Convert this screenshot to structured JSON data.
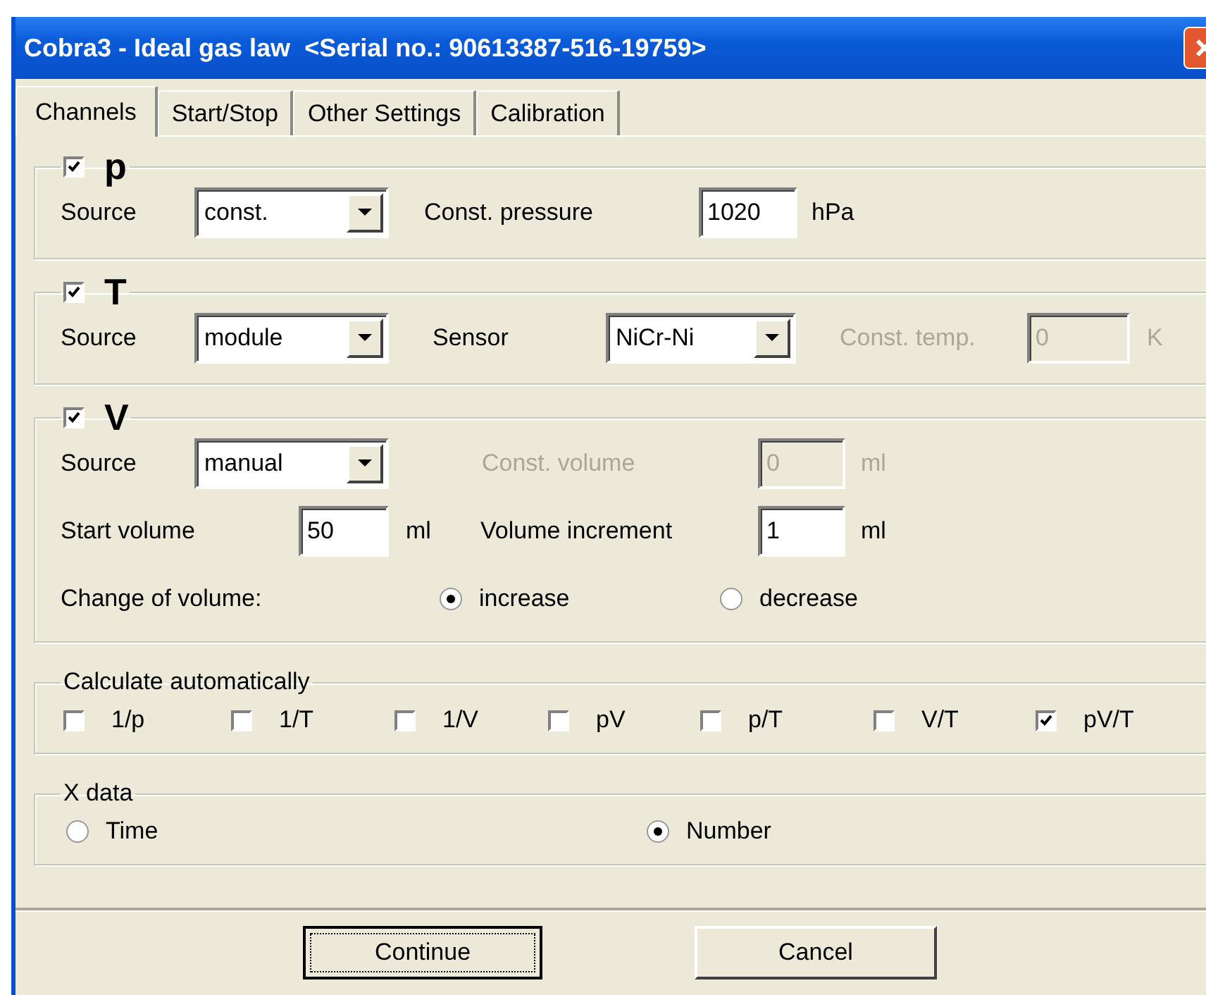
{
  "window": {
    "title": "Cobra3 - Ideal gas law  <Serial no.: 90613387-516-19759>"
  },
  "tabs": [
    {
      "label": "Channels",
      "selected": true
    },
    {
      "label": "Start/Stop",
      "selected": false
    },
    {
      "label": "Other Settings",
      "selected": false
    },
    {
      "label": "Calibration",
      "selected": false
    }
  ],
  "pressure": {
    "label": "p",
    "checked": true,
    "source": {
      "label": "Source",
      "value": "const."
    },
    "const_pressure": {
      "label": "Const. pressure",
      "value": "1020",
      "unit": "hPa"
    }
  },
  "temperature": {
    "label": "T",
    "checked": true,
    "source": {
      "label": "Source",
      "value": "module"
    },
    "sensor": {
      "label": "Sensor",
      "value": "NiCr-Ni"
    },
    "const_temp": {
      "label": "Const. temp.",
      "value": "0",
      "unit": "K",
      "disabled": true
    }
  },
  "volume": {
    "label": "V",
    "checked": true,
    "source": {
      "label": "Source",
      "value": "manual"
    },
    "const_volume": {
      "label": "Const. volume",
      "value": "0",
      "unit": "ml",
      "disabled": true
    },
    "start_volume": {
      "label": "Start volume",
      "value": "50",
      "unit": "ml"
    },
    "volume_increment": {
      "label": "Volume increment",
      "value": "1",
      "unit": "ml"
    },
    "change_of_volume": {
      "label": "Change of volume:",
      "options": [
        {
          "label": "increase",
          "selected": true
        },
        {
          "label": "decrease",
          "selected": false
        }
      ]
    }
  },
  "calculate": {
    "title": "Calculate automatically",
    "options": [
      {
        "label": "1/p",
        "checked": false
      },
      {
        "label": "1/T",
        "checked": false
      },
      {
        "label": "1/V",
        "checked": false
      },
      {
        "label": "pV",
        "checked": false
      },
      {
        "label": "p/T",
        "checked": false
      },
      {
        "label": "V/T",
        "checked": false
      },
      {
        "label": "pV/T",
        "checked": true
      }
    ]
  },
  "x_data": {
    "title": "X data",
    "options": [
      {
        "label": "Time",
        "selected": false
      },
      {
        "label": "Number",
        "selected": true
      }
    ]
  },
  "buttons": [
    {
      "label": "Continue",
      "focused": true
    },
    {
      "label": "Cancel",
      "focused": false
    }
  ]
}
